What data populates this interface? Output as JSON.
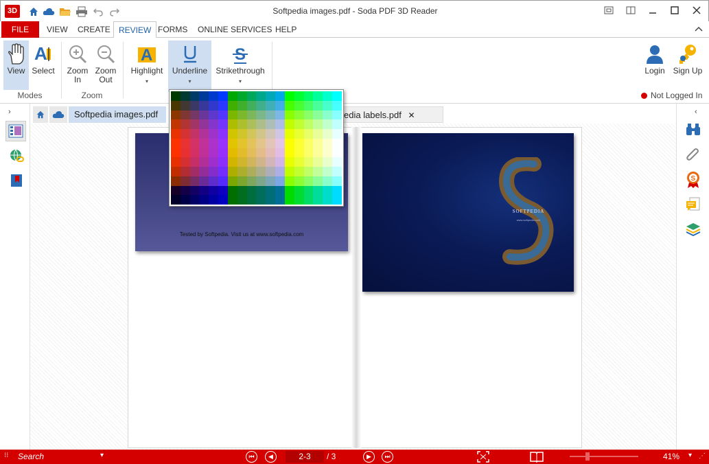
{
  "window": {
    "title": "Softpedia images.pdf   -   Soda PDF 3D Reader",
    "app_logo": "3D"
  },
  "menu": {
    "file": "FILE",
    "items": [
      "VIEW",
      "CREATE",
      "REVIEW",
      "FORMS",
      "ONLINE SERVICES",
      "HELP"
    ]
  },
  "ribbon": {
    "view": "View",
    "select": "Select",
    "modes_group": "Modes",
    "zoom_in": "Zoom\nIn",
    "zoom_out": "Zoom\nOut",
    "zoom_group": "Zoom",
    "highlight": "Highlight",
    "underline": "Underline",
    "strikethrough": "Strikethrough",
    "login": "Login",
    "sign_up": "Sign Up",
    "status": "Not Logged In"
  },
  "tabs": {
    "tab1": "Softpedia images.pdf",
    "tab2_visible": "edia labels.pdf"
  },
  "document": {
    "left_caption": "Tested by Softpedia. Visit us at www.softpedia.com",
    "right_brand": "SOFTPEDIA",
    "right_url": "www.softpedia.com"
  },
  "statusbar": {
    "search_placeholder": "Search",
    "page_value": "2-3",
    "page_total": "/ 3",
    "zoom": "41%"
  },
  "colors": {
    "accent_red": "#d40000",
    "selected_blue": "#cfdff1",
    "review_blue": "#1f5fa5"
  },
  "icons": [
    "home-icon",
    "cloud-icon",
    "open-folder-icon",
    "print-icon",
    "undo-icon",
    "redo-icon",
    "hand-icon",
    "select-text-icon",
    "zoom-in-icon",
    "zoom-out-icon",
    "highlight-icon",
    "underline-icon",
    "strikethrough-icon",
    "user-icon",
    "key-icon",
    "binoculars-icon",
    "paperclip-icon",
    "seal-icon",
    "comment-icon",
    "layers-icon"
  ]
}
